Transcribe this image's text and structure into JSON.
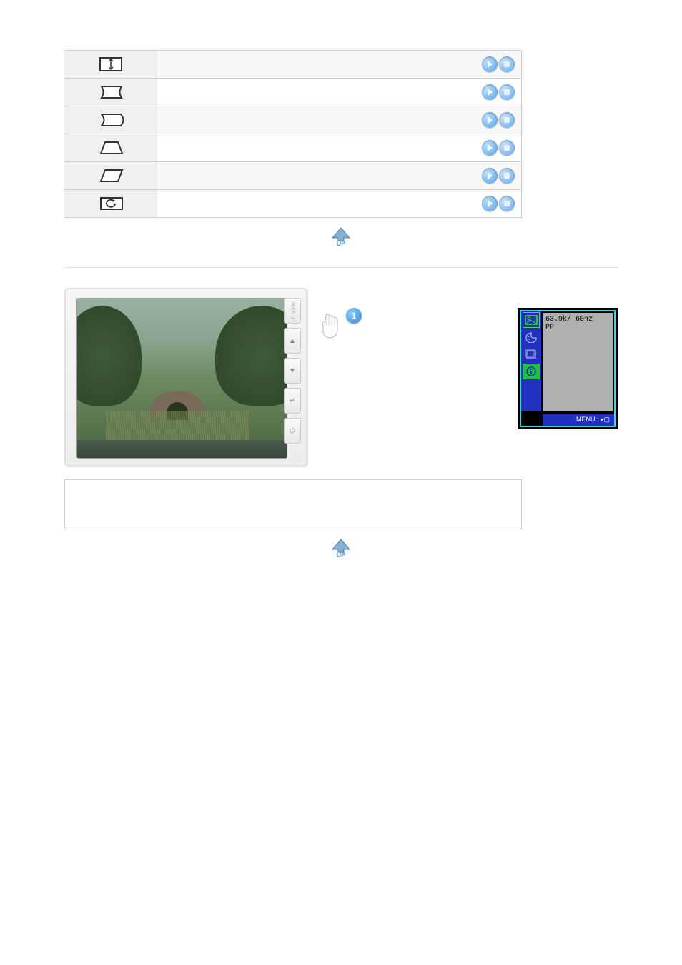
{
  "table": {
    "rows": [
      {
        "icon": "v-size",
        "play": true,
        "stop": true
      },
      {
        "icon": "pincushion",
        "play": true,
        "stop": true
      },
      {
        "icon": "pin-balance",
        "play": true,
        "stop": true
      },
      {
        "icon": "trapezoid",
        "play": true,
        "stop": true
      },
      {
        "icon": "parallel",
        "play": true,
        "stop": true
      },
      {
        "icon": "geometry-recall",
        "play": true,
        "stop": true
      }
    ]
  },
  "monitor": {
    "side_buttons": {
      "menu": "MENU",
      "up": "▲",
      "down": "▼",
      "enter": "↵",
      "power": "⏻"
    }
  },
  "hand_step": "1",
  "osd": {
    "freq": "63.9k/ 60hz",
    "mode": "PP",
    "footer": "MENU : ▸▢"
  },
  "up_badge": "UP"
}
